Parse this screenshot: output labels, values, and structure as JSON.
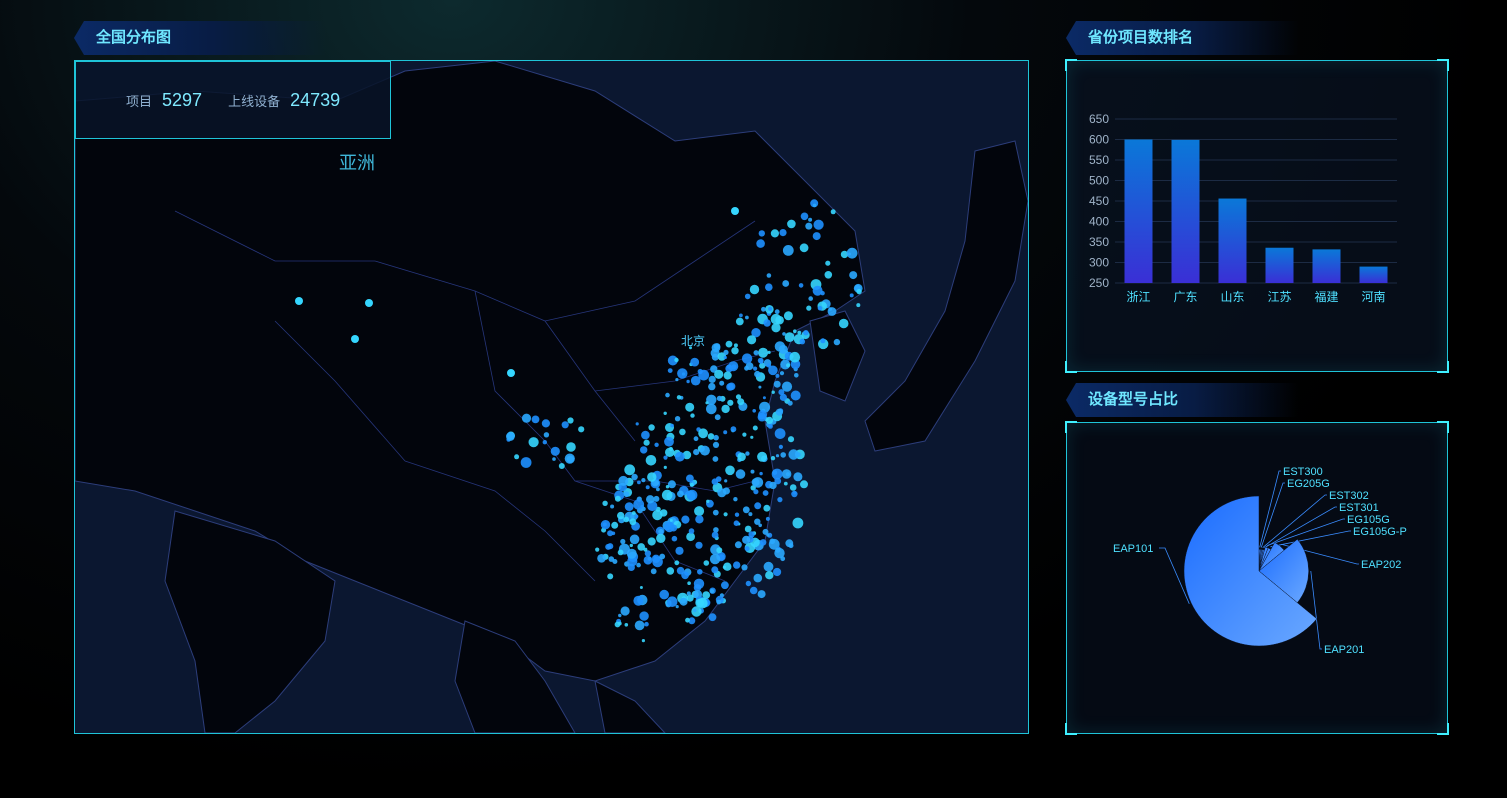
{
  "map_section": {
    "title": "全国分布图",
    "stats": {
      "projects_label": "项目",
      "projects_value": "5297",
      "devices_label": "上线设备",
      "devices_value": "24739"
    },
    "region_label": "亚洲",
    "city_label": "北京"
  },
  "ranking_section": {
    "title": "省份项目数排名",
    "chart_data": {
      "type": "bar",
      "categories": [
        "浙江",
        "广东",
        "山东",
        "江苏",
        "福建",
        "河南"
      ],
      "values": [
        600,
        599,
        456,
        336,
        332,
        290
      ],
      "ylim": [
        250,
        650
      ],
      "yticks": [
        650,
        600,
        550,
        500,
        450,
        400,
        350,
        300,
        250
      ],
      "grid": true,
      "bar_gradient": [
        "#0a78d8",
        "#3a2fd6"
      ]
    }
  },
  "device_section": {
    "title": "设备型号占比",
    "chart_data": {
      "type": "pie",
      "rose": true,
      "categories": [
        "EST300",
        "EG205G",
        "EST302",
        "EST301",
        "EG105G",
        "EG105G-P",
        "EAP202",
        "EAP201",
        "EAP101"
      ],
      "values": [
        1,
        1,
        1,
        1,
        2,
        2,
        6,
        22,
        64
      ],
      "gradient": [
        "#1a6cff",
        "#6aa8ff"
      ]
    }
  },
  "colors": {
    "accent": "#1fc4d8",
    "title_text": "#6fe7ff",
    "dots": [
      "#1e90ff",
      "#35d6ff",
      "#2aa8ff"
    ]
  }
}
